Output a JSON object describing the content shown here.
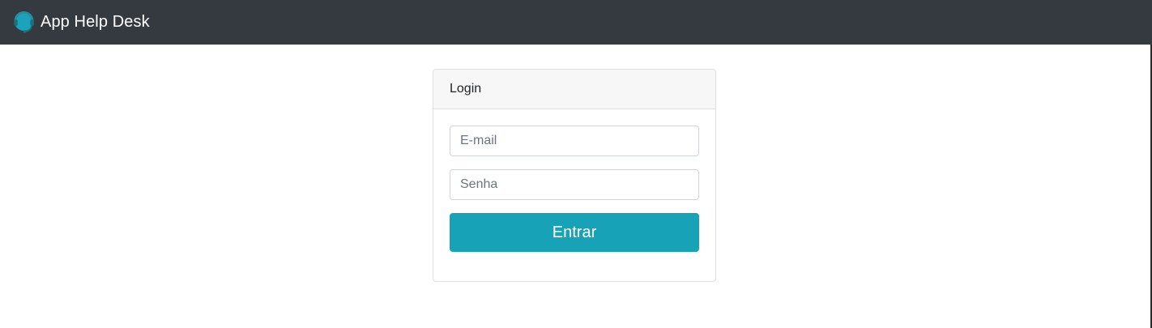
{
  "navbar": {
    "brand_title": "App Help Desk",
    "logo_icon": "headset-support-icon",
    "background": "#343a40"
  },
  "login_card": {
    "header_title": "Login",
    "email_field": {
      "placeholder": "E-mail",
      "value": ""
    },
    "password_field": {
      "placeholder": "Senha",
      "value": ""
    },
    "submit_label": "Entrar",
    "accent_color": "#17a2b8"
  }
}
